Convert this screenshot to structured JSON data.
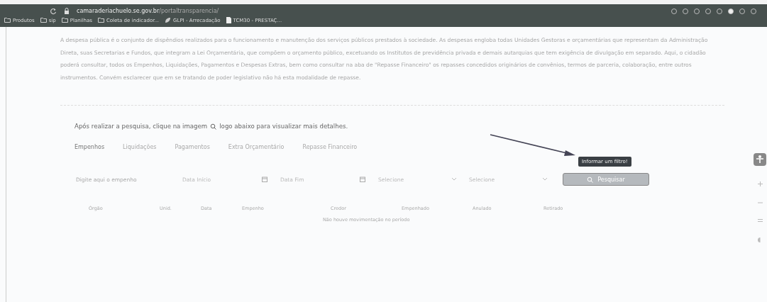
{
  "browser": {
    "url_host": "camaraderiachuelo.se.gov.br",
    "url_path": "/portaltransparencia/",
    "bookmarks": [
      {
        "label": "Produtos",
        "kind": "folder"
      },
      {
        "label": "sip",
        "kind": "folder"
      },
      {
        "label": "Planilhas",
        "kind": "folder"
      },
      {
        "label": "Coleta de indicador...",
        "kind": "folder"
      },
      {
        "label": "GLPI - Arrecadação",
        "kind": "site"
      },
      {
        "label": "TCM30 - PRESTAÇ...",
        "kind": "page"
      }
    ]
  },
  "intro": "A despesa pública é o conjunto de dispêndios realizados para o funcionamento e manutenção dos serviços públicos prestados à sociedade. As despesas engloba todas Unidades Gestoras e orçamentárias que representam da Administração Direta, suas Secretarias e Fundos, que integram a Lei Orçamentária, que compõem o orçamento público, excetuando os Institutos de previdência privada e demais autarquias que tem exigência de divulgação em separado. Aqui, o cidadão poderá consultar, todos os Empenhos, Liquidações, Pagamentos e Despesas Extras, bem como consultar na aba de \"Repasse Financeiro\" os repasses concedidos originários de convênios, termos de parceria, colaboração, entre outros instrumentos. Convém esclarecer que em se tratando de poder legislativo não há esta modalidade de repasse.",
  "hint_before": "Após realizar a pesquisa, clique na imagem",
  "hint_after": "logo abaixo para visualizar mais detalhes.",
  "tabs": [
    {
      "label": "Empenhos",
      "selected": true
    },
    {
      "label": "Liquidações",
      "selected": false
    },
    {
      "label": "Pagamentos",
      "selected": false
    },
    {
      "label": "Extra Orçamentário",
      "selected": false
    },
    {
      "label": "Repasse Financeiro",
      "selected": false
    }
  ],
  "filters": [
    {
      "kind": "text",
      "placeholder": "Digite aqui o empenho"
    },
    {
      "kind": "date",
      "placeholder": "Data Início"
    },
    {
      "kind": "date",
      "placeholder": "Data Fim"
    },
    {
      "kind": "select",
      "placeholder": "Selecione"
    },
    {
      "kind": "select",
      "placeholder": "Selecione"
    }
  ],
  "search_button": "Pesquisar",
  "tooltip": "Informar um filtro!",
  "table": {
    "columns": [
      "Órgão",
      "Unid.",
      "Data",
      "Empenho",
      "Credor",
      "Empenhado",
      "Anulado",
      "Retirado"
    ],
    "empty_message": "Não houve movimentação no período"
  }
}
